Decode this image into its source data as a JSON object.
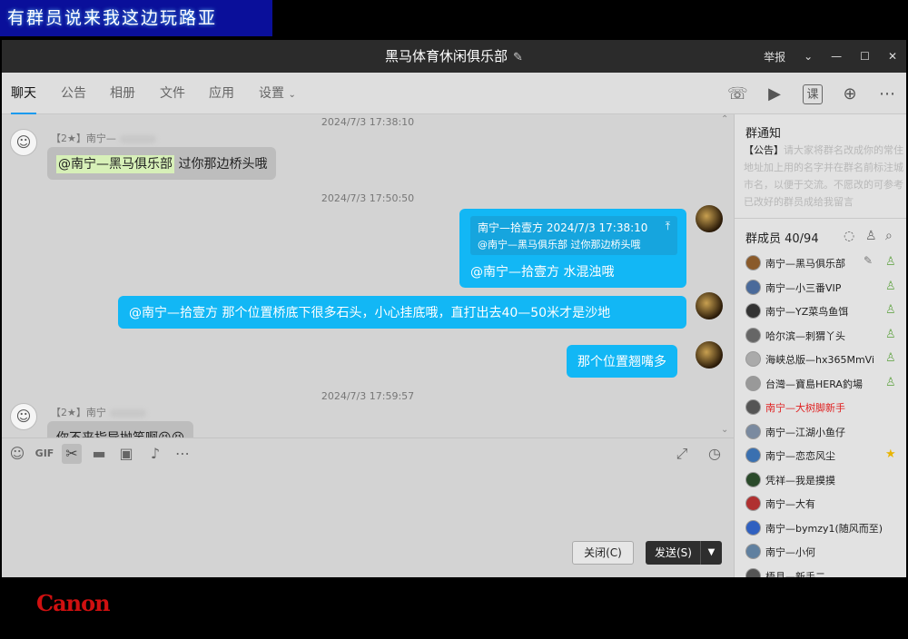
{
  "caption": "有群员说来我这边玩路亚",
  "window": {
    "title": "黑马体育休闲俱乐部",
    "report": "举报"
  },
  "tabs": [
    "聊天",
    "公告",
    "相册",
    "文件",
    "应用",
    "设置"
  ],
  "messages": {
    "ts1": "2024/7/3 17:38:10",
    "m1_nick": "【2★】南宁—",
    "m1_mention": "@南宁—黑马俱乐部",
    "m1_text": " 过你那边桥头哦",
    "ts2": "2024/7/3 17:50:50",
    "q_head": "南宁—拾壹方   2024/7/3 17:38:10",
    "q_body": "@南宁—黑马俱乐部 过你那边桥头哦",
    "m2_text": "@南宁—拾壹方  水混浊哦",
    "m3_text": "@南宁—拾壹方 那个位置桥底下很多石头，小心挂底哦，直打出去40—50米才是沙地",
    "m4_text": "那个位置翘嘴多",
    "ts3": "2024/7/3 17:59:57",
    "m5_nick": "【2★】南宁",
    "m5_text": "你不来指导抛竿啊😆😆"
  },
  "input": {
    "close_label": "关闭(C)",
    "send_label": "发送(S)"
  },
  "sidebar": {
    "notice_title": "群通知",
    "notice_tag": "【公告】",
    "notice_text": "请大家将群名改成你的常住地址加上用的名字并在群名前标注城市名，以便于交流。不愿改的可参考已改好的群员成给我留言",
    "members_title": "群成员 40/94",
    "members": [
      {
        "name": "南宁—黑马俱乐部",
        "color": "#8a5a2a",
        "badge": "owner"
      },
      {
        "name": "南宁—小三番VIP",
        "color": "#4a6a9a",
        "badge": "admin"
      },
      {
        "name": "南宁—YZ菜鸟鱼饵",
        "color": "#333",
        "badge": "admin"
      },
      {
        "name": "哈尔滨—刺猬丫头",
        "color": "#666",
        "badge": "admin"
      },
      {
        "name": "海峡总版—hx365MmVi",
        "color": "#aaa",
        "badge": "admin"
      },
      {
        "name": "台灣—寶島HERA釣場",
        "color": "#999",
        "badge": "admin"
      },
      {
        "name": "南宁—大树脚新手",
        "color": "#555",
        "badge": "",
        "red": true
      },
      {
        "name": "南宁—江湖小鱼仔",
        "color": "#7a8aa0",
        "badge": ""
      },
      {
        "name": "南宁—恋恋风尘",
        "color": "#3a70b0",
        "badge": "star"
      },
      {
        "name": "凭祥—我是摸摸",
        "color": "#2a4a2a",
        "badge": ""
      },
      {
        "name": "南宁—大有",
        "color": "#b03030",
        "badge": ""
      },
      {
        "name": "南宁—bymzy1(随风而至)",
        "color": "#3060c0",
        "badge": ""
      },
      {
        "name": "南宁—小何",
        "color": "#6080a0",
        "badge": ""
      },
      {
        "name": "梧县—新手二",
        "color": "#555",
        "badge": ""
      }
    ]
  },
  "watermark": "Canon"
}
